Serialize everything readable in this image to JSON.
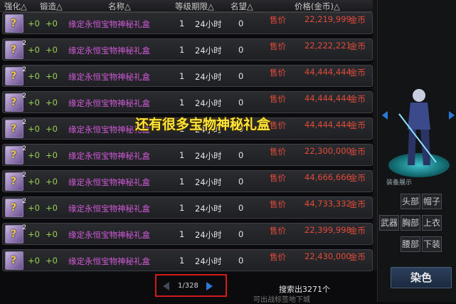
{
  "headers": [
    "强化△",
    "锻造△",
    "名称△",
    "等级期限△",
    "名望△",
    "价格(金币)△"
  ],
  "rows": [
    {
      "count": "",
      "reinforce": "+0",
      "forge": "+0",
      "name": "缘定永恒宝物神秘礼盒",
      "level": "1",
      "term": "24小时",
      "fame": "0",
      "sell_label": "售价",
      "price": "22,219,999",
      "currency": "金币"
    },
    {
      "count": "2",
      "reinforce": "+0",
      "forge": "+0",
      "name": "缘定永恒宝物神秘礼盒",
      "level": "1",
      "term": "24小时",
      "fame": "0",
      "sell_label": "售价",
      "price": "22,222,221",
      "currency": "金币"
    },
    {
      "count": "2",
      "reinforce": "+0",
      "forge": "+0",
      "name": "缘定永恒宝物神秘礼盒",
      "level": "1",
      "term": "24小时",
      "fame": "0",
      "sell_label": "售价",
      "price": "44,444,444",
      "currency": "金币"
    },
    {
      "count": "2",
      "reinforce": "+0",
      "forge": "+0",
      "name": "缘定永恒宝物神秘礼盒",
      "level": "1",
      "term": "24小时",
      "fame": "0",
      "sell_label": "售价",
      "price": "44,444,444",
      "currency": "金币"
    },
    {
      "count": "2",
      "reinforce": "+0",
      "forge": "+0",
      "name": "缘定永恒宝物神秘礼盒",
      "level": "1",
      "term": "24小时",
      "fame": "0",
      "sell_label": "售价",
      "price": "44,444,444",
      "currency": "金币"
    },
    {
      "count": "2",
      "reinforce": "+0",
      "forge": "+0",
      "name": "缘定永恒宝物神秘礼盒",
      "level": "1",
      "term": "24小时",
      "fame": "0",
      "sell_label": "售价",
      "price": "22,300,000",
      "currency": "金币"
    },
    {
      "count": "2",
      "reinforce": "+0",
      "forge": "+0",
      "name": "缘定永恒宝物神秘礼盒",
      "level": "1",
      "term": "24小时",
      "fame": "0",
      "sell_label": "售价",
      "price": "44,666,666",
      "currency": "金币"
    },
    {
      "count": "2",
      "reinforce": "+0",
      "forge": "+0",
      "name": "缘定永恒宝物神秘礼盒",
      "level": "1",
      "term": "24小时",
      "fame": "0",
      "sell_label": "售价",
      "price": "44,733,332",
      "currency": "金币"
    },
    {
      "count": "2",
      "reinforce": "+0",
      "forge": "+0",
      "name": "缘定永恒宝物神秘礼盒",
      "level": "1",
      "term": "24小时",
      "fame": "0",
      "sell_label": "售价",
      "price": "22,399,998",
      "currency": "金币"
    },
    {
      "count": "",
      "reinforce": "+0",
      "forge": "+0",
      "name": "缘定永恒宝物神秘礼盒",
      "level": "1",
      "term": "24小时",
      "fame": "0",
      "sell_label": "售价",
      "price": "22,430,000",
      "currency": "金币"
    }
  ],
  "overlay_text": "还有很多宝物神秘礼盒",
  "pagination": {
    "page_text": "1/328"
  },
  "search_count": "搜索出3271个",
  "hint_text": "可出战标签地下城",
  "right_panel": {
    "tagline": "装备展示",
    "slots": [
      "头部",
      "帽子",
      "武器",
      "胸部",
      "上衣",
      "腰部",
      "下装"
    ],
    "dye_button": "染色"
  },
  "colors": {
    "name": "#d05ad8",
    "price": "#e24a3a",
    "overlay": "#ffe53a",
    "pager_highlight": "#d11a1a"
  }
}
